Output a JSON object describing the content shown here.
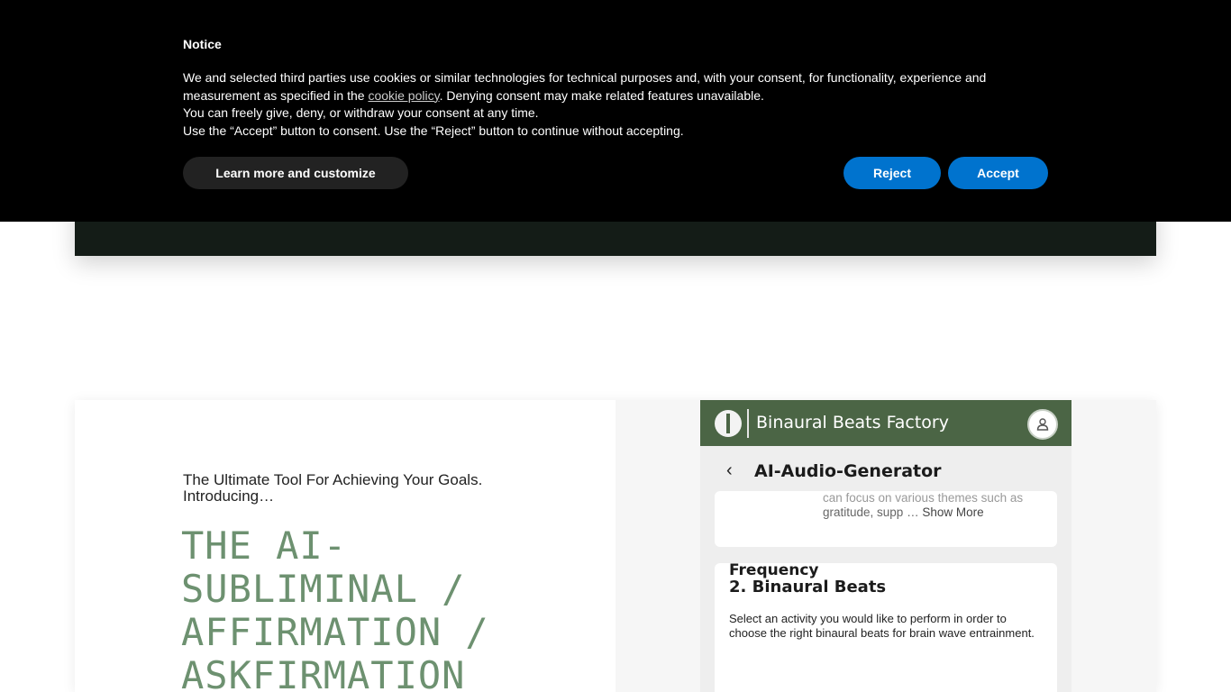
{
  "notice": {
    "title": "Notice",
    "body_line1": "We and selected third parties use cookies or similar technologies for technical purposes and, with your consent, for functionality, experience and measurement as specified in the ",
    "link_text": "cookie policy",
    "body_line1_end": ". Denying consent may make related features unavailable.",
    "body_line2": "You can freely give, deny, or withdraw your consent at any time.",
    "body_line3": "Use the “Accept” button to consent. Use the “Reject” button to continue without accepting.",
    "learn_label": "Learn more and customize",
    "reject_label": "Reject",
    "accept_label": "Accept",
    "button_color": "#0073ce"
  },
  "hero": {
    "intro": "The Ultimate Tool For Achieving Your Goals. Introducing…",
    "headline": "THE AI-SUBLIMINAL / AFFIRMATION / ASKFIRMATION",
    "headline_color": "#6d9170"
  },
  "app": {
    "title": "Binaural Beats Factory",
    "bar_color": "#4b6545",
    "page_heading": "AI-Audio-Generator",
    "card1_cut": "can focus on various themes such as",
    "card1_text": "gratitude, supp …",
    "show_more": "Show More",
    "section_heading": "2. Binaural Beats",
    "section_text": "Select an activity you would like to perform in order to choose the right binaural beats for brain wave entrainment.",
    "frequency_label": "Frequency",
    "icons": [
      "back-chevron-icon",
      "user-icon",
      "app-logo-icon"
    ]
  }
}
